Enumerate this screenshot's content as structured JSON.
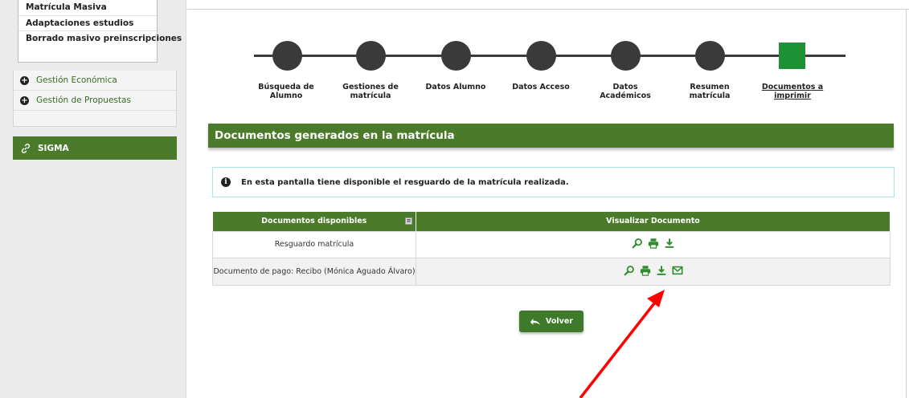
{
  "sidebar": {
    "submenu": [
      "Matrícula Masiva",
      "Adaptaciones estudios",
      "Borrado masivo preinscripciones"
    ],
    "menu": [
      "Gestión Económica",
      "Gestión de Propuestas"
    ],
    "sigma_label": "SIGMA"
  },
  "stepper": {
    "steps": [
      {
        "line1": "Búsqueda de",
        "line2": "Alumno"
      },
      {
        "line1": "Gestiones de",
        "line2": "matrícula"
      },
      {
        "line1": "Datos Alumno",
        "line2": ""
      },
      {
        "line1": "Datos Acceso",
        "line2": ""
      },
      {
        "line1": "Datos",
        "line2": "Académicos"
      },
      {
        "line1": "Resumen",
        "line2": "matrícula"
      },
      {
        "line1": "Documentos a",
        "line2": "imprimir"
      }
    ],
    "active_index": 6
  },
  "section": {
    "title": "Documentos generados en la matrícula"
  },
  "info": {
    "message": "En esta pantalla tiene disponible el resguardo de la matrícula realizada."
  },
  "table": {
    "headers": [
      "Documentos disponibles",
      "Visualizar Documento"
    ],
    "rows": [
      {
        "name": "Resguardo matrícula",
        "actions": [
          "search-icon",
          "print-icon",
          "download-icon"
        ]
      },
      {
        "name": "Documento de pago: Recibo (Mónica Aguado Álvaro)",
        "actions": [
          "search-icon",
          "print-icon",
          "download-icon",
          "email-icon"
        ]
      }
    ]
  },
  "buttons": {
    "back_label": "Volver"
  },
  "colors": {
    "brand_green": "#4a7a2a",
    "active_step": "#1e9134",
    "icon_green": "#2e8b2e",
    "annotation_arrow": "#ff0000"
  }
}
